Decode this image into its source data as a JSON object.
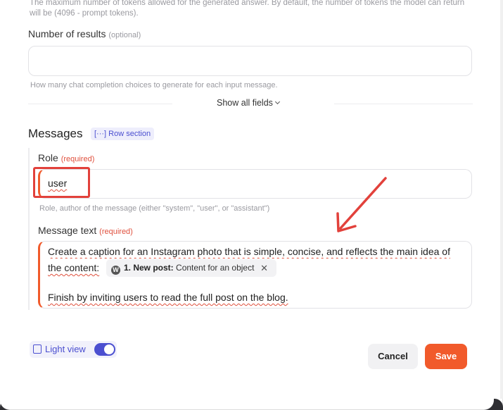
{
  "top_help": "The maximum number of tokens allowed for the generated answer. By default, the number of tokens the model can return will be (4096 - prompt tokens).",
  "number_of_results": {
    "label": "Number of results",
    "optional": "(optional)",
    "value": "",
    "help": "How many chat completion choices to generate for each input message."
  },
  "show_all_fields": "Show all fields",
  "messages": {
    "title": "Messages",
    "badge": "Row section",
    "role": {
      "label": "Role",
      "required": "(required)",
      "value": "user",
      "help": "Role, author of the message (either \"system\", \"user\", or \"assistant\")"
    },
    "message_text": {
      "label": "Message text",
      "required": "(required)",
      "line1": "Create a caption for an Instagram photo that is simple, concise, and reflects the main idea of",
      "line2_prefix": "the content:",
      "chip_bold": "1. New post:",
      "chip_rest": "Content for an object",
      "line3": "Finish by inviting users to read the full post on the blog."
    }
  },
  "footer": {
    "light_view": "Light view",
    "light_view_on": true,
    "cancel": "Cancel",
    "save": "Save"
  },
  "colors": {
    "accent": "#f15a2b",
    "brand": "#4b4fd0",
    "annotation": "#e2413b"
  }
}
